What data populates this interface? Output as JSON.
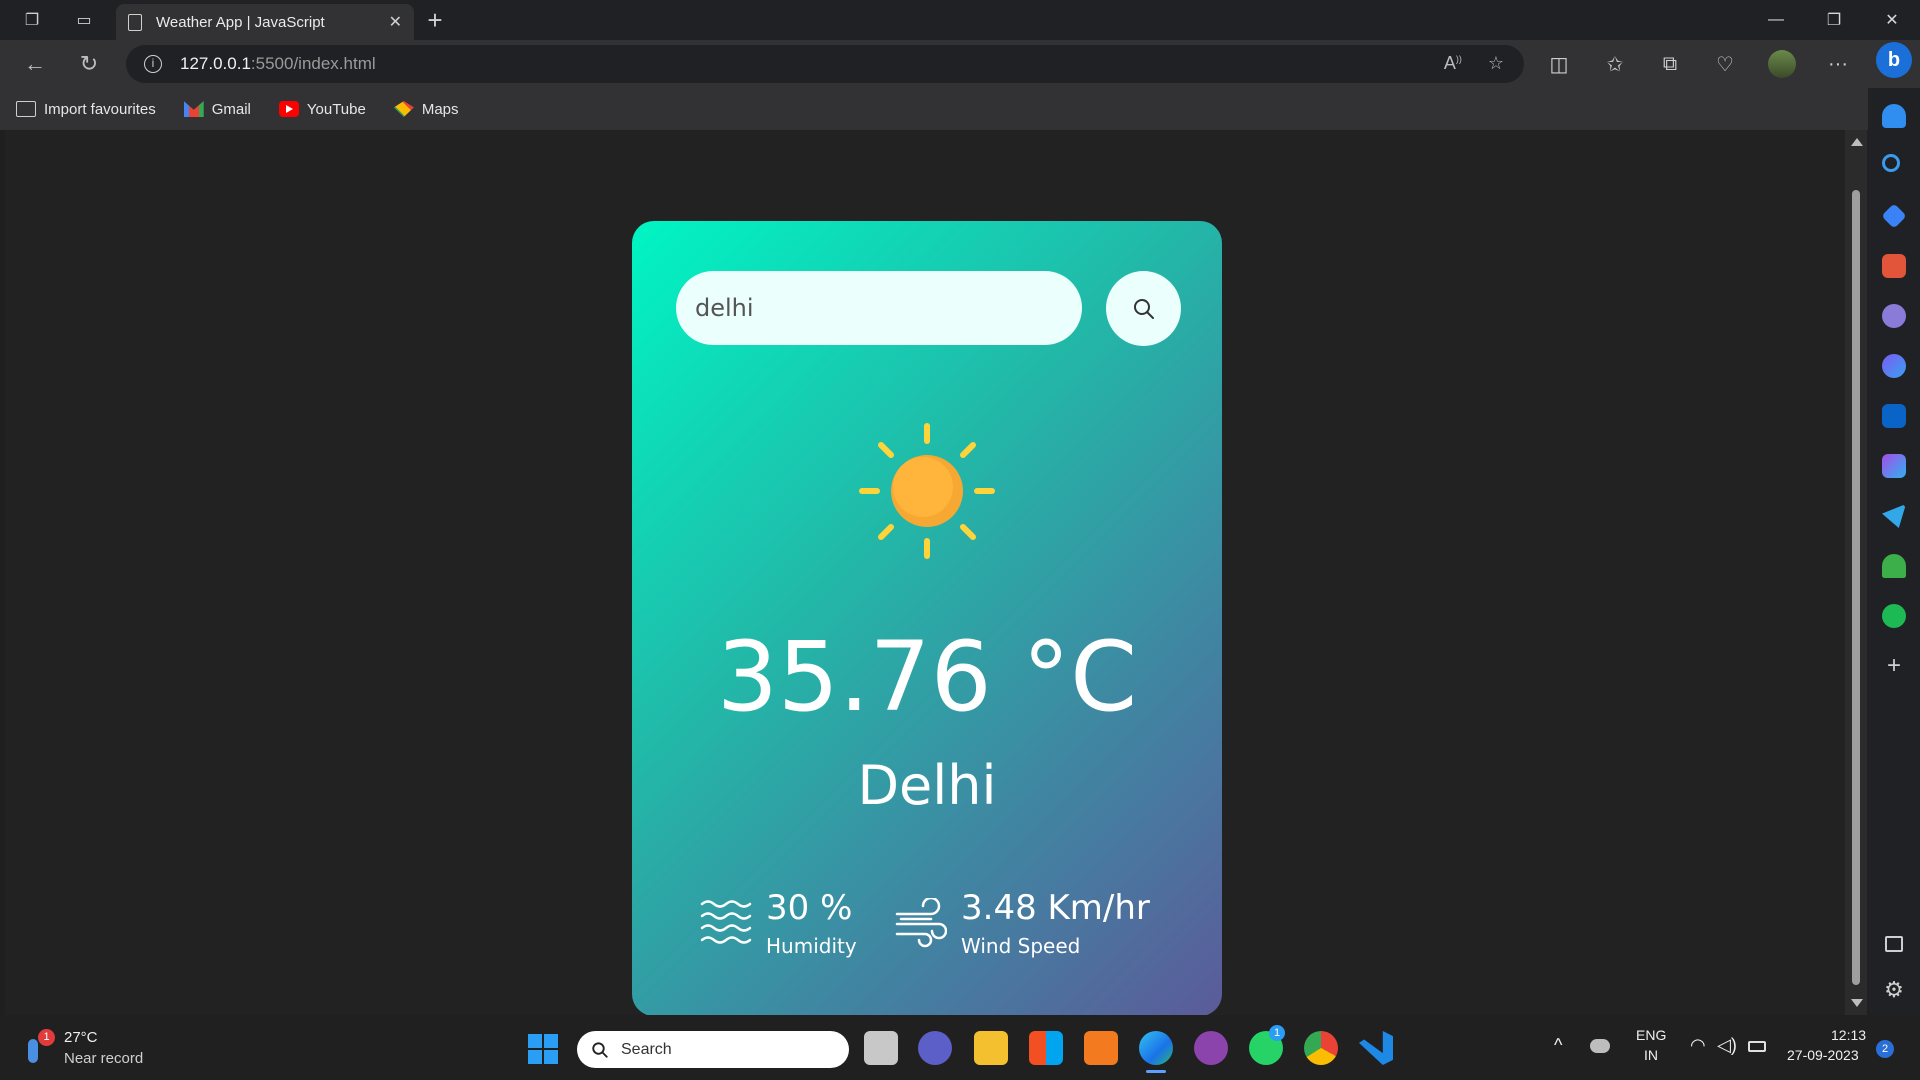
{
  "browser": {
    "tab_title": "Weather App | JavaScript",
    "url_host": "127.0.0.1",
    "url_rest": ":5500/index.html",
    "bookmarks": [
      {
        "label": "Import favourites",
        "icon": "import-icon"
      },
      {
        "label": "Gmail",
        "icon": "gmail-icon"
      },
      {
        "label": "YouTube",
        "icon": "youtube-icon"
      },
      {
        "label": "Maps",
        "icon": "maps-icon"
      }
    ]
  },
  "app": {
    "search_value": "delhi",
    "weather_icon": "sun-icon",
    "temperature": "35.76 °C",
    "city": "Delhi",
    "humidity_value": "30 %",
    "humidity_label": "Humidity",
    "wind_value": "3.48 Km/hr",
    "wind_label": "Wind Speed",
    "colors": {
      "gradient_start": "#00f5c4",
      "gradient_end": "#5b5b9a",
      "sun": "#f7a832",
      "rays": "#ffd43b"
    }
  },
  "taskbar": {
    "weather_temp": "27°C",
    "weather_desc": "Near record",
    "weather_badge": "1",
    "search_placeholder": "Search",
    "whatsapp_badge": "1",
    "lang_top": "ENG",
    "lang_bottom": "IN",
    "time": "12:13",
    "date": "27-09-2023",
    "notification_count": "2"
  }
}
